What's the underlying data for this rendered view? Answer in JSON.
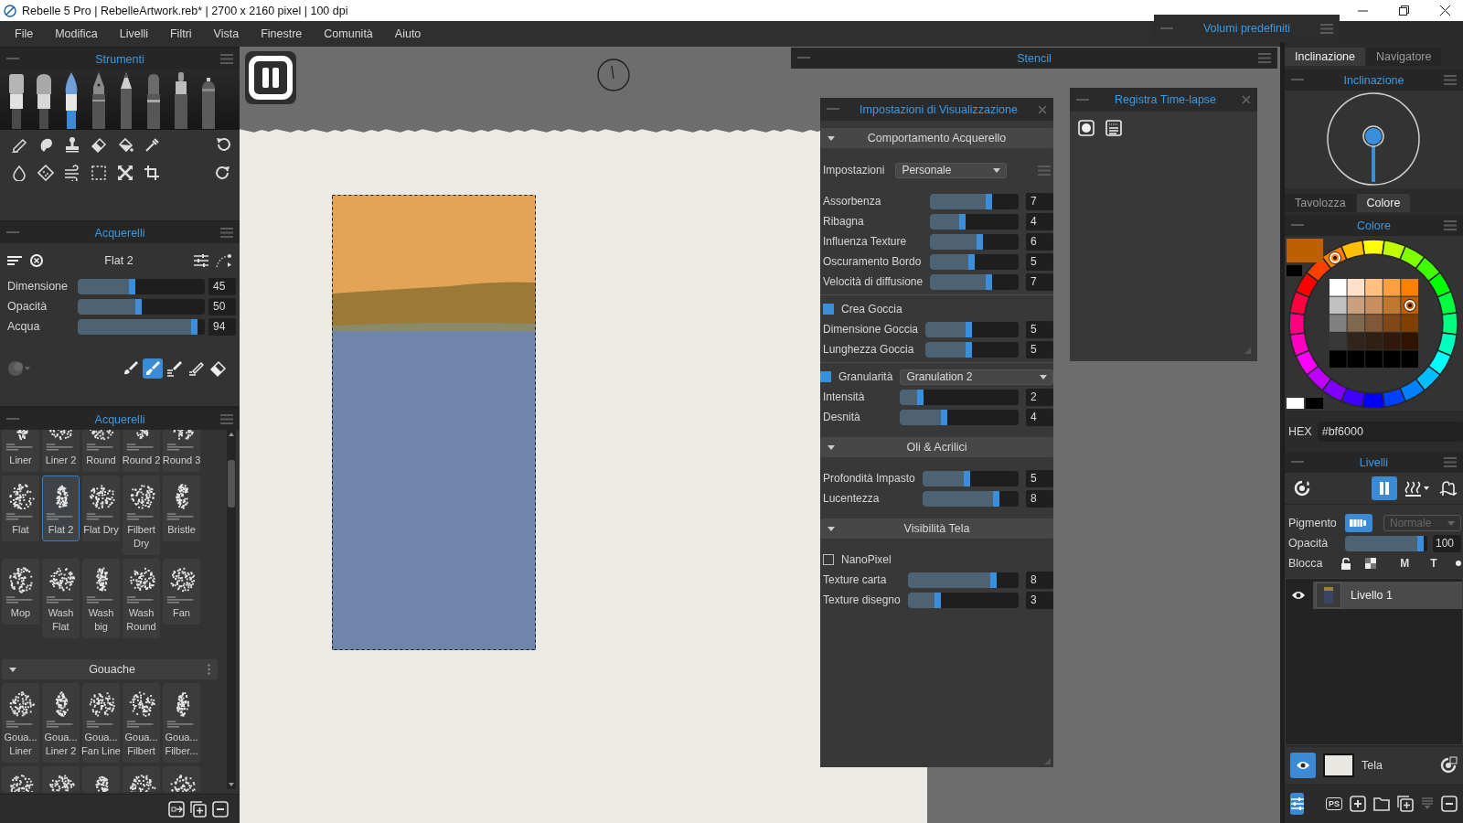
{
  "window": {
    "title": "Rebelle 5 Pro | RebelleArtwork.reb* | 2700 x 2160 pixel | 100 dpi"
  },
  "menu": [
    "File",
    "Modifica",
    "Livelli",
    "Filtri",
    "Vista",
    "Finestre",
    "Comunità",
    "Aiuto"
  ],
  "presets_panel": {
    "title": "Volumi predefiniti"
  },
  "tools_panel": {
    "title": "Strumenti",
    "tools": [
      {
        "kind": "flat",
        "selected": false
      },
      {
        "kind": "filbert",
        "selected": false
      },
      {
        "kind": "round",
        "selected": true
      },
      {
        "kind": "pen",
        "selected": false
      },
      {
        "kind": "pencil",
        "selected": false
      },
      {
        "kind": "marker",
        "selected": false
      },
      {
        "kind": "felt",
        "selected": false
      },
      {
        "kind": "spray",
        "selected": false
      }
    ]
  },
  "brush_panel": {
    "title": "Acquerelli",
    "brush": "Flat 2",
    "sliders": [
      {
        "label": "Dimensione",
        "level": 0.45,
        "value": "45"
      },
      {
        "label": "Opacità",
        "level": 0.5,
        "value": "50"
      },
      {
        "label": "Acqua",
        "level": 0.94,
        "value": "94"
      }
    ],
    "modes": [
      {
        "kind": "paint",
        "selected": false
      },
      {
        "kind": "blend",
        "selected": true
      },
      {
        "kind": "smudge",
        "selected": false
      },
      {
        "kind": "clean",
        "selected": false
      },
      {
        "kind": "erase",
        "selected": false
      }
    ]
  },
  "library": {
    "title": "Acquerelli",
    "brushes": [
      {
        "name": [
          "Liner"
        ],
        "selected": false
      },
      {
        "name": [
          "Liner 2"
        ],
        "selected": false
      },
      {
        "name": [
          "Round"
        ],
        "selected": false
      },
      {
        "name": [
          "Round 2"
        ],
        "selected": false
      },
      {
        "name": [
          "Round 3"
        ],
        "selected": false
      },
      {
        "name": [
          "Flat"
        ],
        "selected": false
      },
      {
        "name": [
          "Flat 2"
        ],
        "selected": true
      },
      {
        "name": [
          "Flat Dry"
        ],
        "selected": false
      },
      {
        "name": [
          "Filbert",
          "Dry"
        ],
        "selected": false
      },
      {
        "name": [
          "Bristle"
        ],
        "selected": false
      },
      {
        "name": [
          "Mop"
        ],
        "selected": false
      },
      {
        "name": [
          "Wash",
          "Flat"
        ],
        "selected": false
      },
      {
        "name": [
          "Wash",
          "big"
        ],
        "selected": false
      },
      {
        "name": [
          "Wash",
          "Round"
        ],
        "selected": false
      },
      {
        "name": [
          "Fan"
        ],
        "selected": false
      }
    ],
    "groups": [
      {
        "title": "Gouache",
        "expanded": true,
        "brushes": [
          {
            "name": [
              "Goua...",
              "Liner"
            ],
            "selected": false
          },
          {
            "name": [
              "Goua...",
              "Liner 2"
            ],
            "selected": false
          },
          {
            "name": [
              "Goua...",
              "Fan Line"
            ],
            "selected": false
          },
          {
            "name": [
              "Goua...",
              "Filbert"
            ],
            "selected": false
          },
          {
            "name": [
              "Goua...",
              "Filber..."
            ],
            "selected": false
          },
          {
            "selected": false
          },
          {
            "selected": false
          },
          {
            "selected": false
          },
          {
            "selected": false
          },
          {
            "selected": false
          }
        ]
      }
    ]
  },
  "stencil": {
    "title": "Stencil"
  },
  "display_settings": {
    "title": "Impostazioni di Visualizzazione",
    "sections": [
      {
        "title": "Comportamento Acquerello",
        "expanded": true,
        "groups": [
          [
            {
              "kind": "select",
              "label": "Impostazioni",
              "value": "Personale"
            },
            {
              "kind": "slider",
              "label": "Assorbenza",
              "level": 0.7,
              "value": "7"
            },
            {
              "kind": "slider",
              "label": "Ribagna",
              "level": 0.4,
              "value": "4"
            },
            {
              "kind": "slider",
              "label": "Influenza Texture",
              "level": 0.6,
              "value": "6"
            },
            {
              "kind": "slider",
              "label": "Oscuramento Bordo",
              "level": 0.5,
              "value": "5"
            },
            {
              "kind": "slider",
              "label": "Velocità di diffusione",
              "level": 0.7,
              "value": "7"
            }
          ],
          [
            {
              "kind": "checkbox",
              "label": "Crea Goccia",
              "checked": true
            },
            {
              "kind": "slider",
              "label": "Dimensione Goccia",
              "level": 0.5,
              "value": "5"
            },
            {
              "kind": "slider",
              "label": "Lunghezza Goccia",
              "level": 0.5,
              "value": "5"
            }
          ],
          [
            {
              "kind": "checkselect",
              "label": "Granularità",
              "checked": true,
              "value": "Granulation 2"
            },
            {
              "kind": "slider",
              "label": "Intensità",
              "level": 0.2,
              "value": "2"
            },
            {
              "kind": "slider",
              "label": "Desnità",
              "level": 0.4,
              "value": "4"
            }
          ]
        ]
      },
      {
        "title": "Oli & Acrilici",
        "expanded": true,
        "groups": [
          [
            {
              "kind": "slider",
              "label": "Profondità Impasto",
              "level": 0.5,
              "value": "5"
            },
            {
              "kind": "slider",
              "label": "Lucentezza",
              "level": 0.8,
              "value": "8"
            }
          ]
        ]
      },
      {
        "title": "Visibilità Tela",
        "expanded": true,
        "groups": [
          [
            {
              "kind": "checkbox",
              "label": "NanoPixel",
              "checked": false
            },
            {
              "kind": "slider",
              "label": "Texture carta",
              "level": 0.8,
              "value": "8"
            },
            {
              "kind": "slider",
              "label": "Texture disegno",
              "level": 0.3,
              "value": "3"
            }
          ]
        ]
      }
    ]
  },
  "timelapse": {
    "title": "Registra Time-lapse"
  },
  "tilt_panel": {
    "tabs": [
      {
        "label": "Inclinazione",
        "selected": true
      },
      {
        "label": "Navigatore",
        "selected": false
      }
    ],
    "title": "Inclinazione"
  },
  "color_panel": {
    "tabs": [
      {
        "label": "Tavolozza",
        "selected": false
      },
      {
        "label": "Colore",
        "selected": true
      }
    ],
    "title": "Colore",
    "color": "#bf6000",
    "hex_label": "HEX",
    "hex": "#bf6000"
  },
  "layers_panel": {
    "title": "Livelli",
    "pigment": {
      "label": "Pigmento",
      "on": true
    },
    "blend_mode": {
      "value": "Normale",
      "disabled": true
    },
    "opacity": {
      "label": "Opacità",
      "level": 0.96,
      "value": "100"
    },
    "lock": {
      "label": "Blocca",
      "toggles": [
        "M",
        "T"
      ]
    },
    "layers": [
      {
        "name": "Livello 1",
        "selected": true,
        "visible": true
      }
    ],
    "canvas_layer": {
      "name": "Tela",
      "visible": true
    },
    "psd_button": "PS"
  }
}
